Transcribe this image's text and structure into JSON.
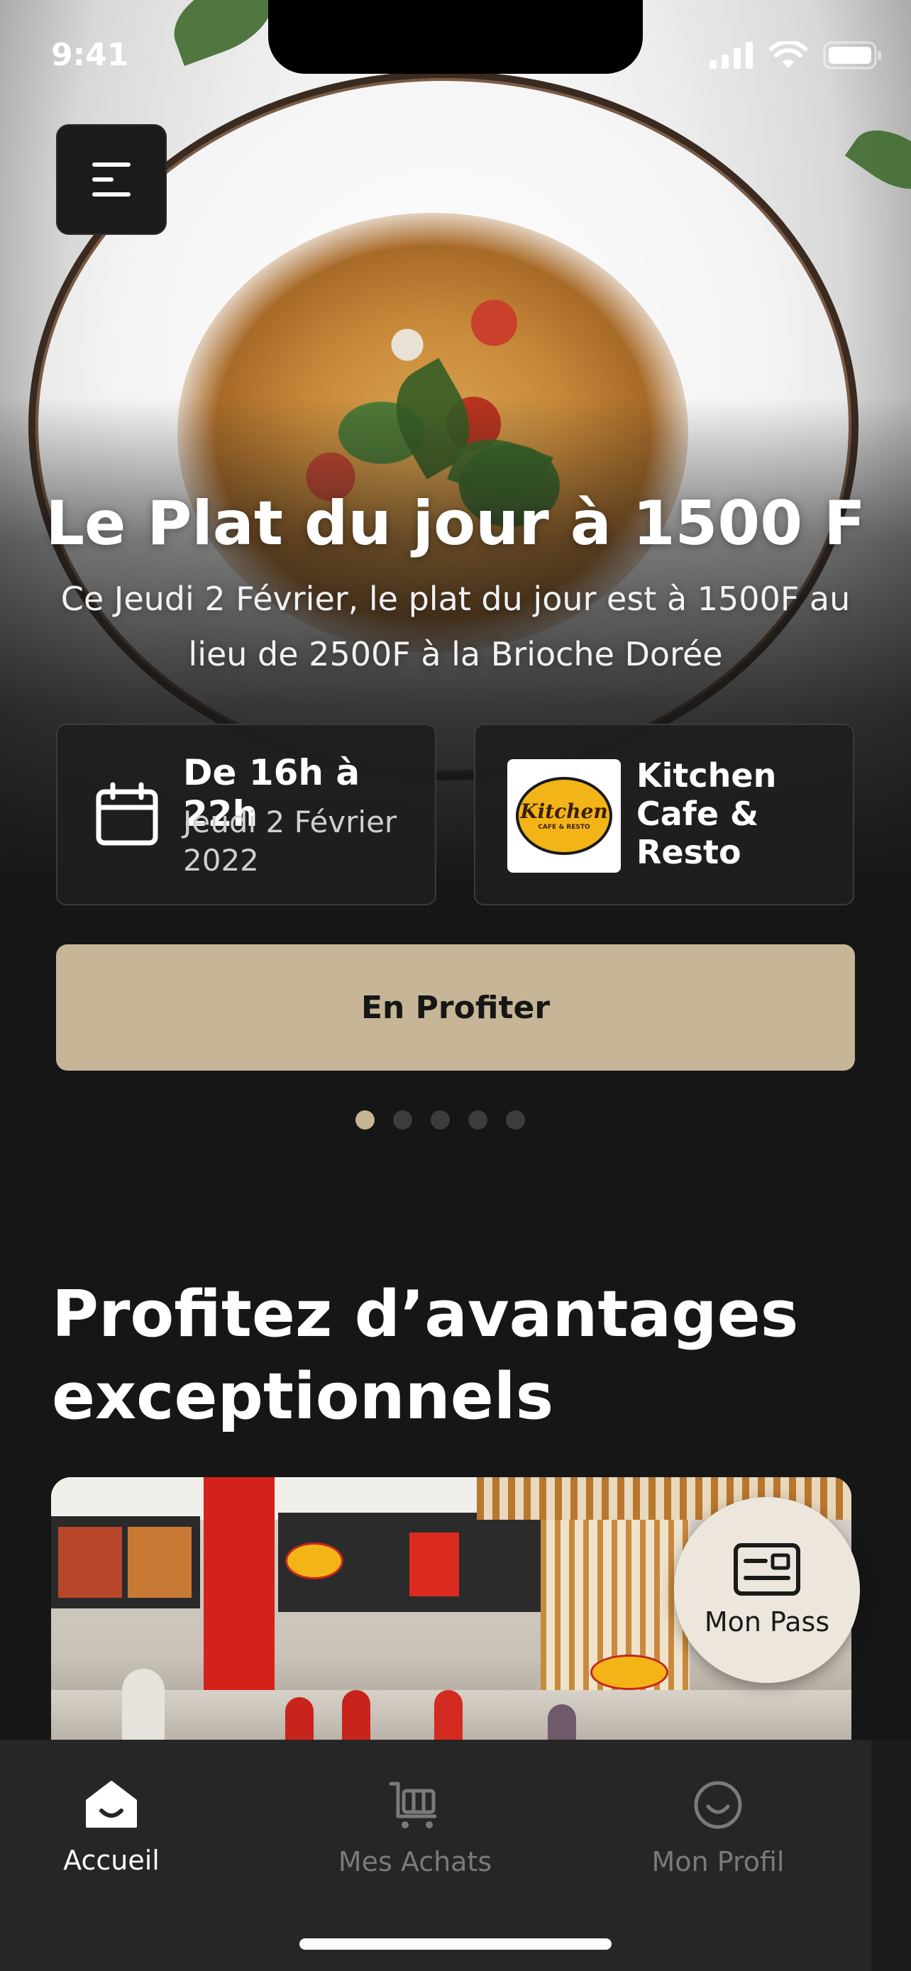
{
  "status_bar": {
    "time": "9:41"
  },
  "hero": {
    "title": "Le Plat du jour à 1500 F",
    "description": "Ce Jeudi 2 Février, le plat du jour est à 1500F au lieu de 2500F à la Brioche Dorée"
  },
  "date_card": {
    "time_range": "De 16h à 22h",
    "date": "Jeudi 2 Février 2022"
  },
  "restaurant_card": {
    "logo_text": "Kitchen",
    "logo_subtext": "CAFE & RESTO",
    "name": "Kitchen Cafe & Resto"
  },
  "cta": {
    "label": "En Profiter"
  },
  "carousel": {
    "count": 5,
    "active_index": 0
  },
  "section": {
    "title": "Profitez d’avantages exceptionnels"
  },
  "floating_pass": {
    "label": "Mon Pass"
  },
  "tabbar": {
    "items": [
      {
        "label": "Accueil",
        "icon": "home-icon",
        "active": true
      },
      {
        "label": "Mes Achats",
        "icon": "cart-icon",
        "active": false
      },
      {
        "label": "Mon Profil",
        "icon": "smile-icon",
        "active": false
      }
    ]
  },
  "colors": {
    "background": "#161616",
    "accent": "#c6b596",
    "tabbar": "#262626",
    "inactive_tab": "#7a7a7a"
  }
}
